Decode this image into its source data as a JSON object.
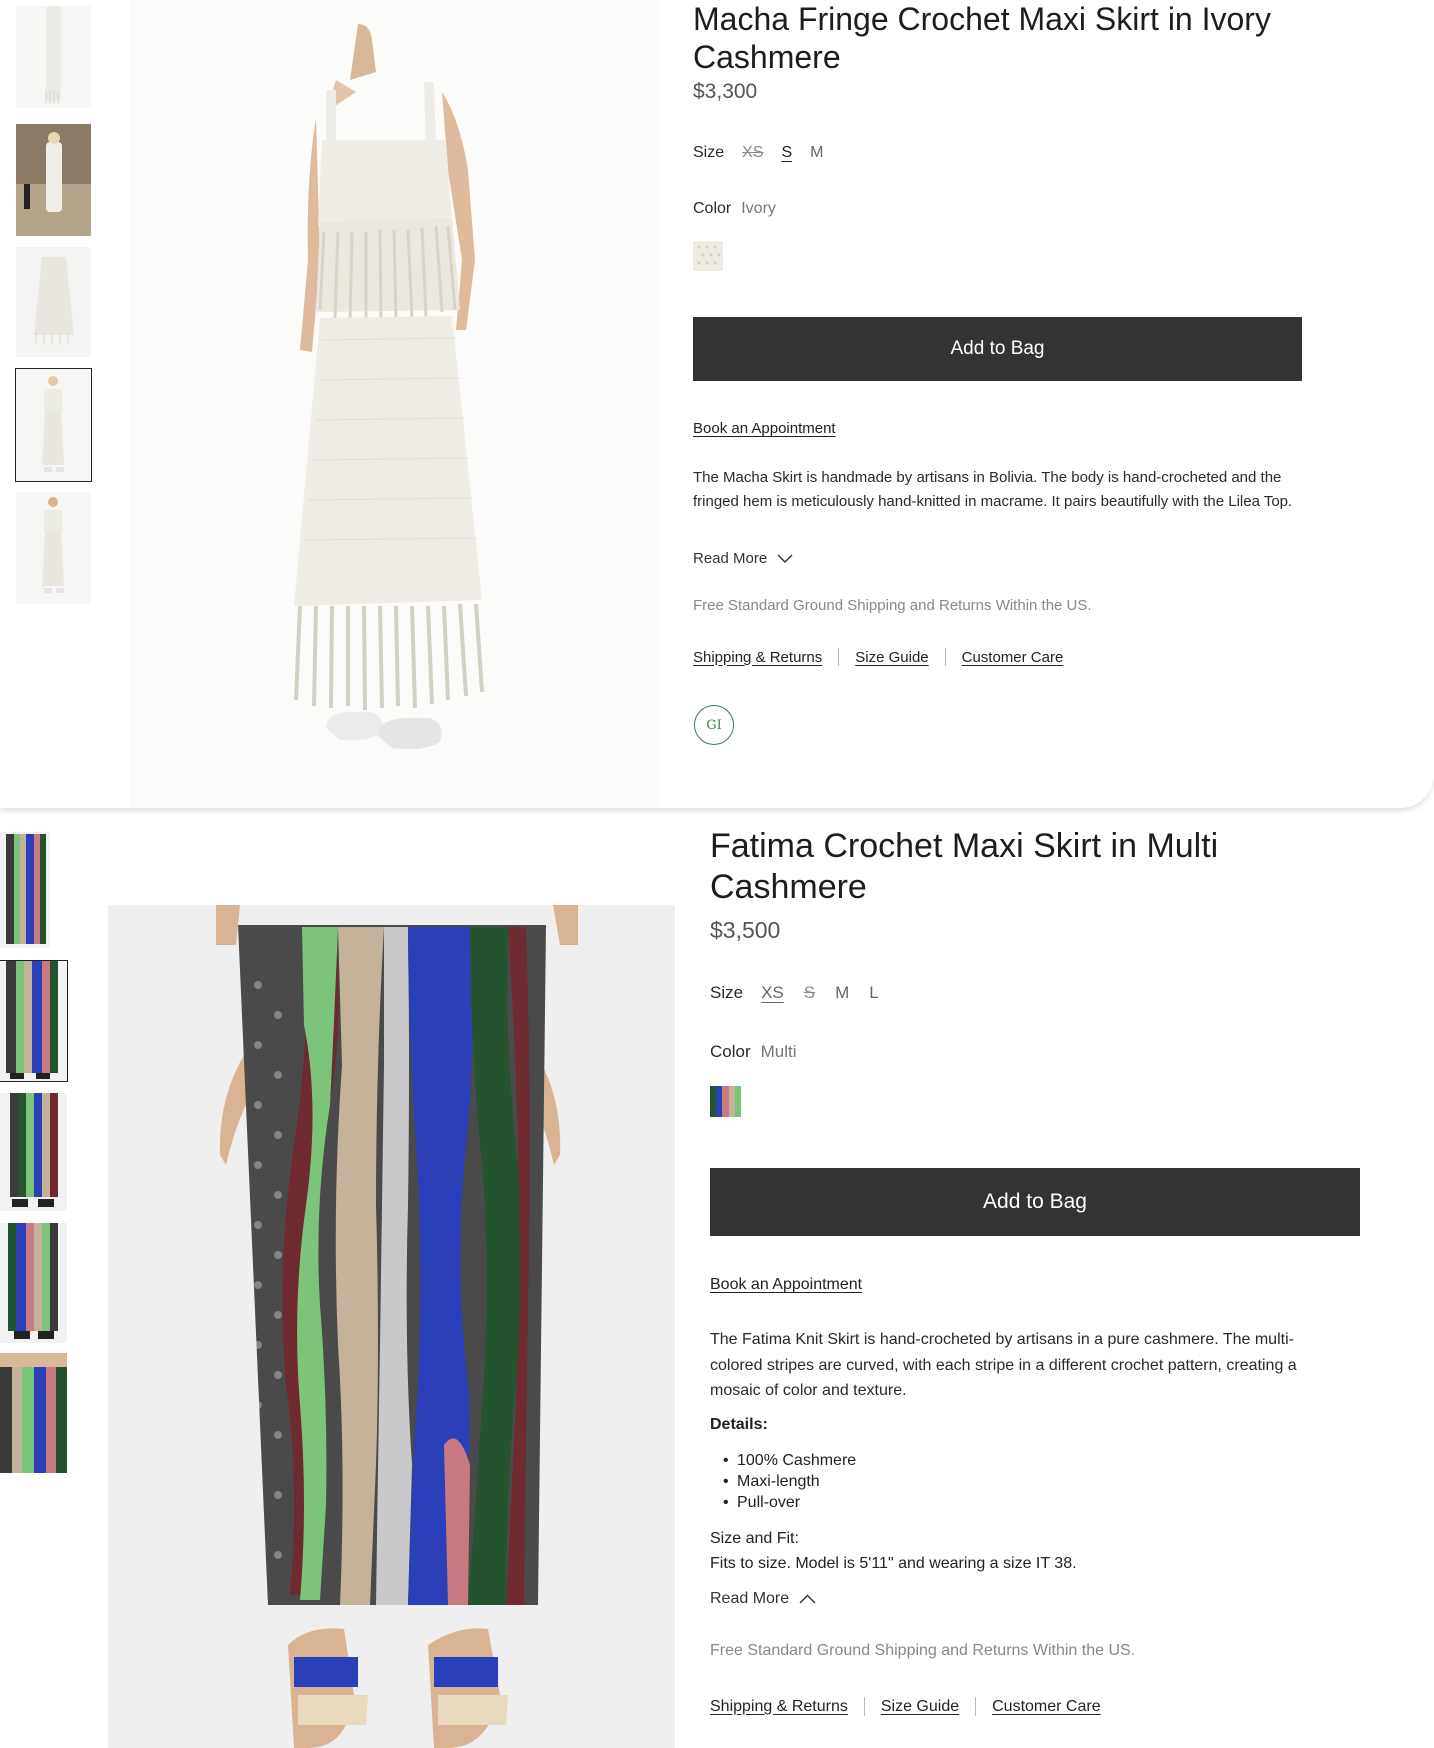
{
  "products": [
    {
      "title": "Macha Fringe Crochet Maxi Skirt in Ivory Cashmere",
      "price": "$3,300",
      "size_label": "Size",
      "sizes": [
        {
          "label": "XS",
          "state": "unavailable"
        },
        {
          "label": "S",
          "state": "selected"
        },
        {
          "label": "M",
          "state": "available"
        }
      ],
      "color_label": "Color",
      "color_value": "Ivory",
      "add_to_bag": "Add to Bag",
      "appointment": "Book an Appointment",
      "description": "The Macha Skirt is handmade by artisans in Bolivia. The body is hand-crocheted and the fringed hem is meticulously hand-knitted in macrame. It pairs beautifully with the Lilea Top.",
      "read_more": "Read More",
      "shipping_note": "Free Standard Ground Shipping and Returns Within the US.",
      "links": [
        "Shipping & Returns",
        "Size Guide",
        "Customer Care"
      ],
      "badge": "GI",
      "thumbnail_count": 5,
      "active_thumbnail": 4
    },
    {
      "title": "Fatima Crochet Maxi Skirt in Multi Cashmere",
      "price": "$3,500",
      "size_label": "Size",
      "sizes": [
        {
          "label": "XS",
          "state": "selected"
        },
        {
          "label": "S",
          "state": "unavailable"
        },
        {
          "label": "M",
          "state": "available"
        },
        {
          "label": "L",
          "state": "available"
        }
      ],
      "color_label": "Color",
      "color_value": "Multi",
      "add_to_bag": "Add to Bag",
      "appointment": "Book an Appointment",
      "description": "The Fatima Knit Skirt is hand-crocheted by artisans in a pure cashmere. The multi-colored stripes are curved, with each stripe in a different crochet pattern, creating a mosaic of color and texture.",
      "details_heading": "Details:",
      "details": [
        "100% Cashmere",
        "Maxi-length",
        "Pull-over"
      ],
      "size_fit_heading": "Size and Fit:",
      "size_fit_text": "Fits to size. Model is 5'11\" and wearing a size IT 38.",
      "read_more": "Read More",
      "shipping_note": "Free Standard Ground Shipping and Returns Within the US.",
      "links": [
        "Shipping & Returns",
        "Size Guide",
        "Customer Care"
      ],
      "thumbnail_count": 5,
      "active_thumbnail": 2
    }
  ],
  "colors": {
    "button_bg": "#333333",
    "button_text": "#ffffff",
    "badge_green": "#3c7a4a",
    "stripe_charcoal": "#4a4a4a",
    "stripe_green": "#7cc47a",
    "stripe_maroon": "#6e2a30",
    "stripe_beige": "#c4b29a",
    "stripe_grey": "#c9c9cc",
    "stripe_blue": "#2a3fb8",
    "stripe_pink": "#c97a80",
    "stripe_darkgreen": "#24532f"
  }
}
